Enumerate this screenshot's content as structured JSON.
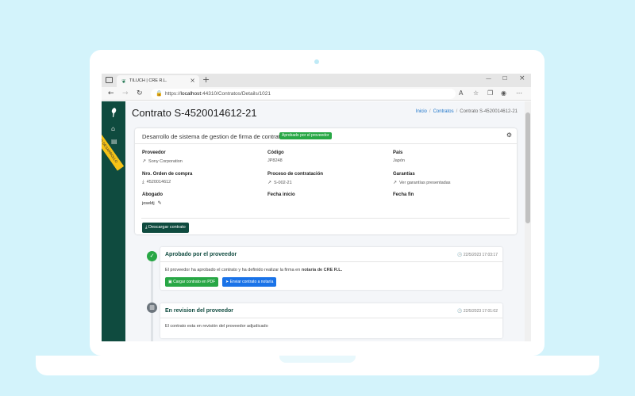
{
  "browser": {
    "tab_title": "TILUCH | CRE R.L.",
    "url_prefix": "https://",
    "url_host": "localhost",
    "url_path": ":44310/Contratos/Details/1021"
  },
  "sidebar": {
    "ribbon": "EN DESARROLLO"
  },
  "page": {
    "title": "Contrato S-4520014612-21",
    "breadcrumb": [
      "Inicio",
      "Contratos",
      "Contrato S-4520014612-21"
    ]
  },
  "card": {
    "title": "Desarrollo de sistema de gestion de firma de contratos",
    "badge": "Aprobado por el proveedor",
    "fields": {
      "proveedor_label": "Proveedor",
      "proveedor_value": "Sony Corporation",
      "codigo_label": "Código",
      "codigo_value": "JP8248",
      "pais_label": "País",
      "pais_value": "Japón",
      "orden_label": "Nro. Orden de compra",
      "orden_value": "4520014612",
      "proceso_label": "Proceso de contratación",
      "proceso_value": "S-002-21",
      "garantias_label": "Garantías",
      "garantias_value": "Ver garantías presentadas",
      "abogado_label": "Abogado",
      "abogado_value": "joseldj",
      "fecha_inicio_label": "Fecha inicio",
      "fecha_fin_label": "Fecha fin"
    },
    "download_label": "Descargar contrato"
  },
  "timeline": [
    {
      "title": "Aprobado por el proveedor",
      "time": "22/5/2023 17:03:17",
      "body_prefix": "El proveedor ha aprobado el contrato y ha definido realizar la firma en ",
      "body_bold": "notaría de CRE R.L.",
      "btn1": "Cargar contrato en PDF",
      "btn2": "Enviar contrato a notaría",
      "status_color": "#28a745"
    },
    {
      "title": "En revision del proveedor",
      "time": "22/5/2023 17:01:02",
      "body": "El contrato esta en revisión del proveedor adjudicado",
      "status_color": "#6c757d"
    }
  ],
  "icons": {
    "logo": "bird-logo-icon",
    "status_done": "check-icon",
    "status_review": "clipboard-icon"
  }
}
